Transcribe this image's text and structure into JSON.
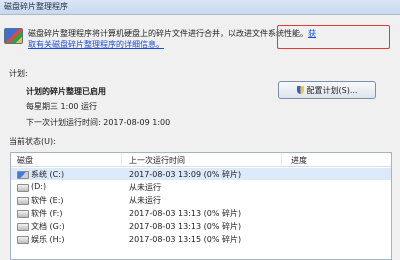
{
  "window": {
    "title": "磁盘碎片整理程序"
  },
  "intro": {
    "text": "磁盘碎片整理程序将计算机硬盘上的碎片文件进行合并，以改进文件系统性能。",
    "link": "获取有关磁盘碎片整理程序的详细信息。"
  },
  "schedule": {
    "section_label": "计划:",
    "status": "计划的碎片整理已启用",
    "run_time": "每星期三 1:00 运行",
    "next_run": "下一次计划运行时间: 2017-08-09 1:00",
    "config_button": "配置计划(S)..."
  },
  "current_status": {
    "section_label": "当前状态(U):",
    "columns": {
      "disk": "磁盘",
      "last_run": "上一次运行时间",
      "progress": "进度"
    },
    "rows": [
      {
        "disk": "系统 (C:)",
        "last_run": "2017-08-03 13:09 (0% 碎片)",
        "icon": "system-drive-icon",
        "selected": true
      },
      {
        "disk": "(D:)",
        "last_run": "从未运行",
        "icon": "drive-icon"
      },
      {
        "disk": "软件 (E:)",
        "last_run": "从未运行",
        "icon": "drive-icon"
      },
      {
        "disk": "软件 (F:)",
        "last_run": "2017-08-03 13:13 (0% 碎片)",
        "icon": "drive-icon"
      },
      {
        "disk": "文档 (G:)",
        "last_run": "2017-08-03 13:13 (0% 碎片)",
        "icon": "drive-icon"
      },
      {
        "disk": "娱乐 (H:)",
        "last_run": "2017-08-03 13:15 (0% 碎片)",
        "icon": "drive-icon"
      }
    ]
  },
  "colors": {
    "link": "#1a4ad6",
    "highlight_box": "#e23a36",
    "selected_row": "#dbe9f9"
  }
}
